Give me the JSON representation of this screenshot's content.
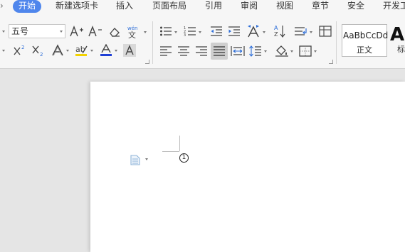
{
  "menubar": {
    "tabs": [
      {
        "label": "开始",
        "active": true
      },
      {
        "label": "新建选项卡"
      },
      {
        "label": "插入"
      },
      {
        "label": "页面布局"
      },
      {
        "label": "引用"
      },
      {
        "label": "审阅"
      },
      {
        "label": "视图"
      },
      {
        "label": "章节"
      },
      {
        "label": "安全"
      },
      {
        "label": "开发工"
      }
    ]
  },
  "ribbon": {
    "font_size": "五号",
    "styles": [
      {
        "sample": "AaBbCcDd",
        "name": "正文"
      },
      {
        "sample": "Aa",
        "name": "标"
      }
    ]
  },
  "document": {
    "cursor_marker": "1"
  },
  "colors": {
    "accent": "#4f86ec",
    "font_color_bar": "#1f3fd6",
    "highlight_bar": "#f2d200"
  }
}
